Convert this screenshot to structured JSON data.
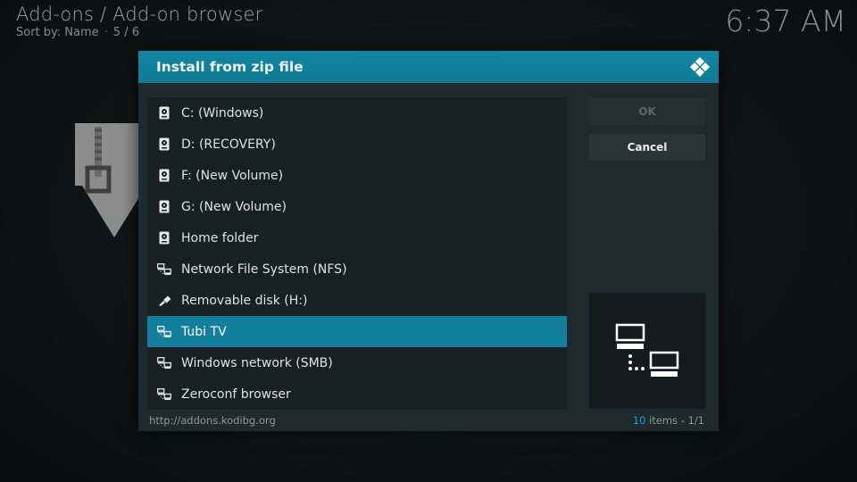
{
  "header": {
    "title": "Add-ons / Add-on browser",
    "sort_label": "Sort by: Name",
    "position": "5 / 6"
  },
  "clock": "6:37 AM",
  "dialog": {
    "title": "Install from zip file",
    "logo_icon": "kodi-logo-icon",
    "items": [
      {
        "label": "C: (Windows)",
        "icon": "hard-drive-icon"
      },
      {
        "label": "D: (RECOVERY)",
        "icon": "hard-drive-icon"
      },
      {
        "label": "F: (New Volume)",
        "icon": "hard-drive-icon"
      },
      {
        "label": "G: (New Volume)",
        "icon": "hard-drive-icon"
      },
      {
        "label": "Home folder",
        "icon": "hard-drive-icon"
      },
      {
        "label": "Network File System (NFS)",
        "icon": "network-icon"
      },
      {
        "label": "Removable disk (H:)",
        "icon": "usb-icon"
      },
      {
        "label": "Tubi TV",
        "icon": "network-icon",
        "selected": true
      },
      {
        "label": "Windows network (SMB)",
        "icon": "network-icon"
      },
      {
        "label": "Zeroconf browser",
        "icon": "network-icon"
      }
    ],
    "ok_label": "OK",
    "cancel_label": "Cancel",
    "preview_icon": "network-icon",
    "footer": {
      "path": "http://addons.kodibg.org",
      "count_number": "10",
      "count_suffix": " items - 1/1"
    }
  },
  "colors": {
    "accent": "#12829e",
    "dialog_bg": "#1e2a2d",
    "selected_row": "#12809c"
  }
}
